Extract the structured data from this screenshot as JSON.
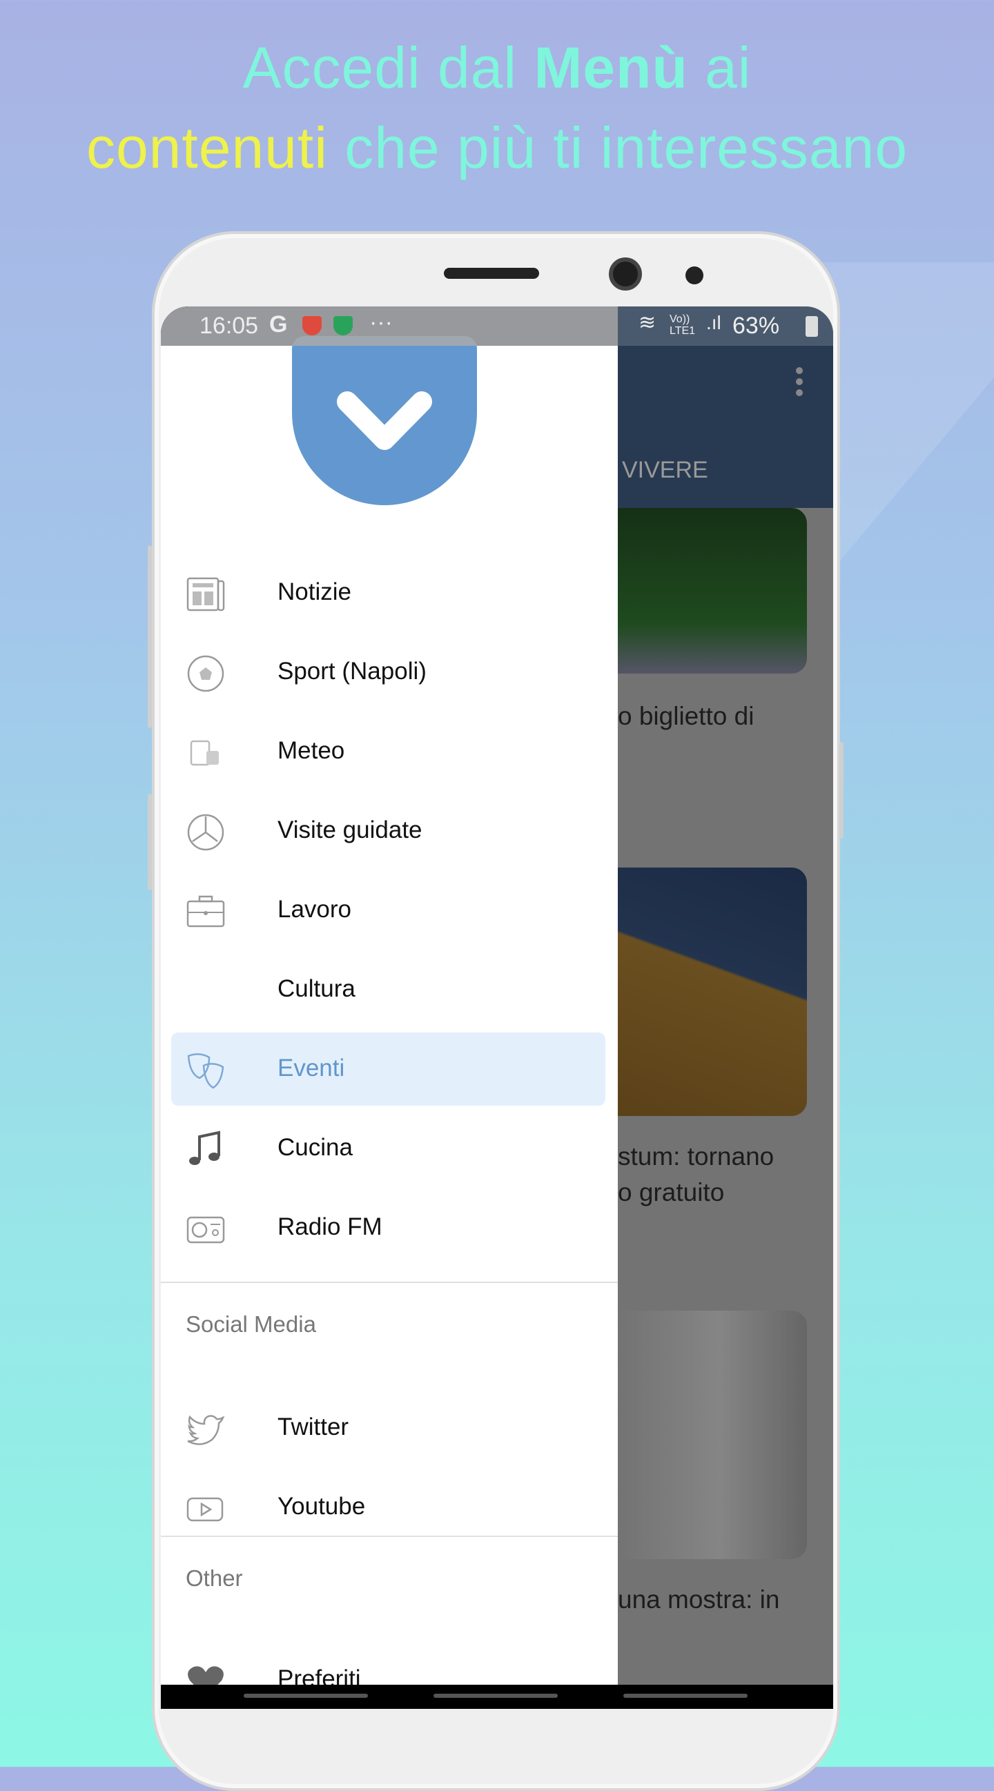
{
  "headline": {
    "line1_prefix": "Accedi dal ",
    "line1_bold": "Menù",
    "line1_suffix": " ai",
    "line2_highlight": "contenuti",
    "line2_rest": " che più ti interessano"
  },
  "colors": {
    "accent": "#6196ca",
    "headline": "#7ff5dc",
    "highlight": "#eef24a",
    "logo": "#6298cf",
    "active_bg": "#e3f0fc"
  },
  "status_bar": {
    "time": "16:05",
    "network": "Vo)) LTE1",
    "battery": "63%"
  },
  "app": {
    "tab_label": "VIVERE"
  },
  "cards": [
    {
      "title": "o biglietto di"
    },
    {
      "title_line1": "stum: tornano",
      "title_line2": "o gratuito"
    },
    {
      "title": "una mostra: in"
    }
  ],
  "drawer": {
    "items": [
      {
        "label": "Notizie",
        "icon": "newspaper-icon"
      },
      {
        "label": "Sport (Napoli)",
        "icon": "soccer-ball-icon"
      },
      {
        "label": "Meteo",
        "icon": "weather-icon"
      },
      {
        "label": "Visite guidate",
        "icon": "clock-icon"
      },
      {
        "label": "Lavoro",
        "icon": "briefcase-icon"
      },
      {
        "label": "Cultura",
        "icon": ""
      },
      {
        "label": "Eventi",
        "icon": "theater-masks-icon",
        "active": true
      },
      {
        "label": "Cucina",
        "icon": "music-note-icon"
      },
      {
        "label": "Radio FM",
        "icon": "radio-icon"
      }
    ],
    "social_header": "Social Media",
    "social": [
      {
        "label": "Twitter",
        "icon": "twitter-icon"
      },
      {
        "label": "Youtube",
        "icon": "youtube-icon"
      }
    ],
    "other_header": "Other",
    "other": [
      {
        "label": "Preferiti",
        "icon": "heart-icon"
      }
    ]
  }
}
